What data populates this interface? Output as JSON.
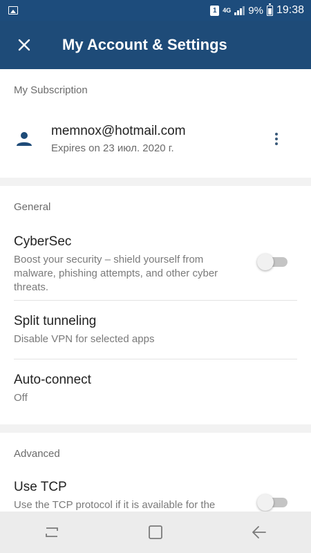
{
  "status_bar": {
    "sim_slot": "1",
    "network": "4G",
    "battery_percent": "9%",
    "time": "19:38"
  },
  "header": {
    "title": "My Account & Settings",
    "close_icon": "close-icon"
  },
  "subscription": {
    "section_label": "My Subscription",
    "email": "memnox@hotmail.com",
    "expiry": "Expires on 23 июл. 2020 г.",
    "avatar_icon": "person-icon",
    "menu_icon": "more-vertical-icon"
  },
  "general": {
    "section_label": "General",
    "items": [
      {
        "title": "CyberSec",
        "description": "Boost your security – shield yourself from malware, phishing attempts, and other cyber threats.",
        "toggle_on": false
      },
      {
        "title": "Split tunneling",
        "description": "Disable VPN for selected apps"
      },
      {
        "title": "Auto-connect",
        "description": "Off"
      }
    ]
  },
  "advanced": {
    "section_label": "Advanced",
    "items": [
      {
        "title": "Use TCP",
        "description": "Use the TCP protocol if it is available for the",
        "toggle_on": false
      }
    ]
  },
  "colors": {
    "header_bg": "#1e4b78",
    "status_bg": "#1d4c7c",
    "accent_icon": "#1e4b78"
  },
  "nav": {
    "recents_icon": "recents-icon",
    "home_icon": "home-icon",
    "back_icon": "back-icon"
  }
}
